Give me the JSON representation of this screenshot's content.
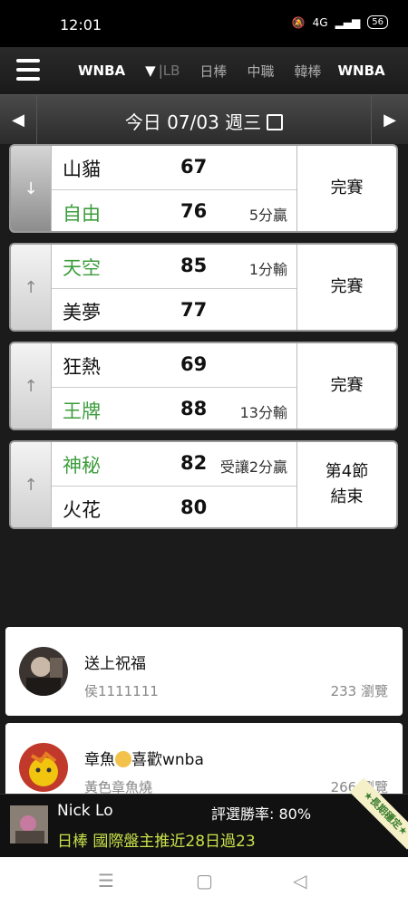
{
  "status_bar": {
    "time": "12:01",
    "net": "4G",
    "battery": "56"
  },
  "nav": {
    "menu_icon": "hamburger-menu-icon",
    "active_tab": "WNBA",
    "caret": "▼",
    "tabs": [
      "LB",
      "日棒",
      "中職",
      "韓棒",
      "WNBA"
    ]
  },
  "date_bar": {
    "prev": "◀",
    "label": "今日 07/03 週三",
    "next": "▶",
    "calendar_icon": "calendar-icon"
  },
  "games": [
    {
      "arrow": "↓",
      "home": {
        "team": "山貓",
        "score": "67",
        "note": "",
        "win": false
      },
      "away": {
        "team": "自由",
        "score": "76",
        "note": "5分贏",
        "win": true
      },
      "status": "完賽"
    },
    {
      "arrow": "↑",
      "home": {
        "team": "天空",
        "score": "85",
        "note": "1分輸",
        "win": true
      },
      "away": {
        "team": "美夢",
        "score": "77",
        "note": "",
        "win": false
      },
      "status": "完賽"
    },
    {
      "arrow": "↑",
      "home": {
        "team": "狂熱",
        "score": "69",
        "note": "",
        "win": false
      },
      "away": {
        "team": "王牌",
        "score": "88",
        "note": "13分輸",
        "win": true
      },
      "status": "完賽"
    },
    {
      "arrow": "↑",
      "home": {
        "team": "神秘",
        "score": "82",
        "note": "受讓2分贏",
        "win": true
      },
      "away": {
        "team": "火花",
        "score": "80",
        "note": "",
        "win": false
      },
      "status_line1": "第4節",
      "status_line2": "結束"
    }
  ],
  "posts": [
    {
      "title": "送上祝福",
      "author": "侯1111111",
      "views": "233 瀏覽"
    },
    {
      "title_pre": "章魚",
      "title_post": "喜歡wnba",
      "author": "黃色章魚燒",
      "views": "266 瀏覽"
    }
  ],
  "promo": {
    "name": "Nick Lo",
    "rate": "評選勝率: 80%",
    "pick": "日棒 國際盤主推近28日過23",
    "badge": "★長期穩定★"
  },
  "system_nav": {
    "menu": "☰",
    "home": "▢",
    "back": "◁"
  }
}
